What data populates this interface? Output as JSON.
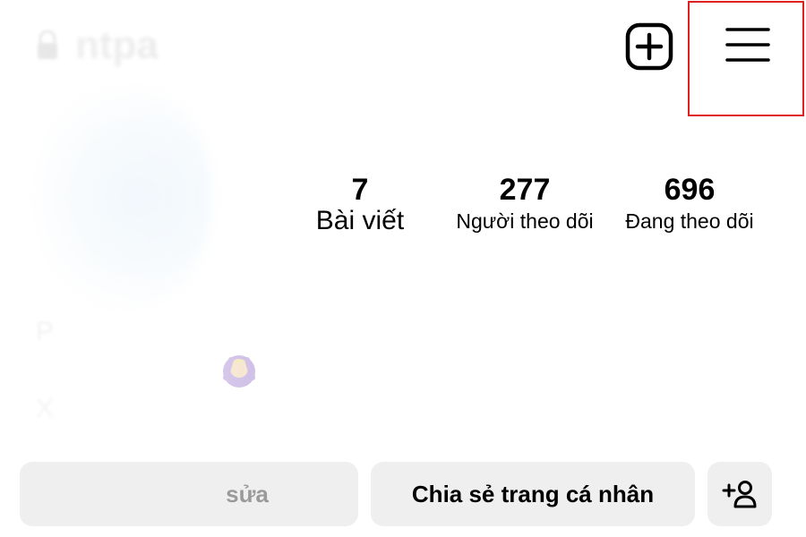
{
  "profile": {
    "username": "ntpa",
    "display_name": "P",
    "bio_line": "X"
  },
  "header": {
    "new_post_icon": "plus-square-icon",
    "menu_icon": "hamburger-menu-icon",
    "highlight_color": "#e02020"
  },
  "stats": {
    "posts": {
      "value": "7",
      "label": "Bài viết"
    },
    "followers": {
      "value": "277",
      "label": "Người theo dõi"
    },
    "following": {
      "value": "696",
      "label": "Đang theo dõi"
    }
  },
  "actions": {
    "edit_label": "sửa",
    "share_label": "Chia sẻ trang cá nhân",
    "add_user_icon": "add-person-icon"
  },
  "colors": {
    "button_bg": "#efefef",
    "text": "#000000"
  }
}
